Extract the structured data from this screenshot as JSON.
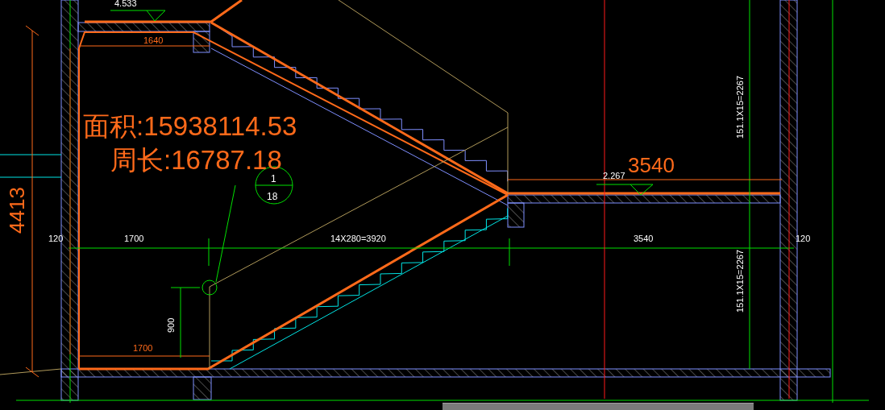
{
  "drawing": {
    "labels": [
      {
        "text": "4.533",
        "kind": "note"
      },
      {
        "text": "1640",
        "kind": "measure"
      },
      {
        "text": "面积:15938114.53",
        "kind": "summary"
      },
      {
        "text": "周长:16787.18",
        "kind": "summary"
      },
      {
        "text": "1",
        "kind": "bubble"
      },
      {
        "text": "18",
        "kind": "bubble"
      },
      {
        "text": "2.267",
        "kind": "note"
      },
      {
        "text": "3540",
        "kind": "measure_large"
      },
      {
        "text": "151.1X15=2267",
        "kind": "note"
      },
      {
        "text": "4413",
        "kind": "measure_large"
      },
      {
        "text": "120",
        "kind": "note"
      },
      {
        "text": "1700",
        "kind": "note"
      },
      {
        "text": "14X280=3920",
        "kind": "note"
      },
      {
        "text": "3540",
        "kind": "note"
      },
      {
        "text": "120",
        "kind": "note"
      },
      {
        "text": "151.1X15=2267",
        "kind": "note"
      },
      {
        "text": "900",
        "kind": "note"
      },
      {
        "text": "1700",
        "kind": "measure"
      }
    ]
  }
}
